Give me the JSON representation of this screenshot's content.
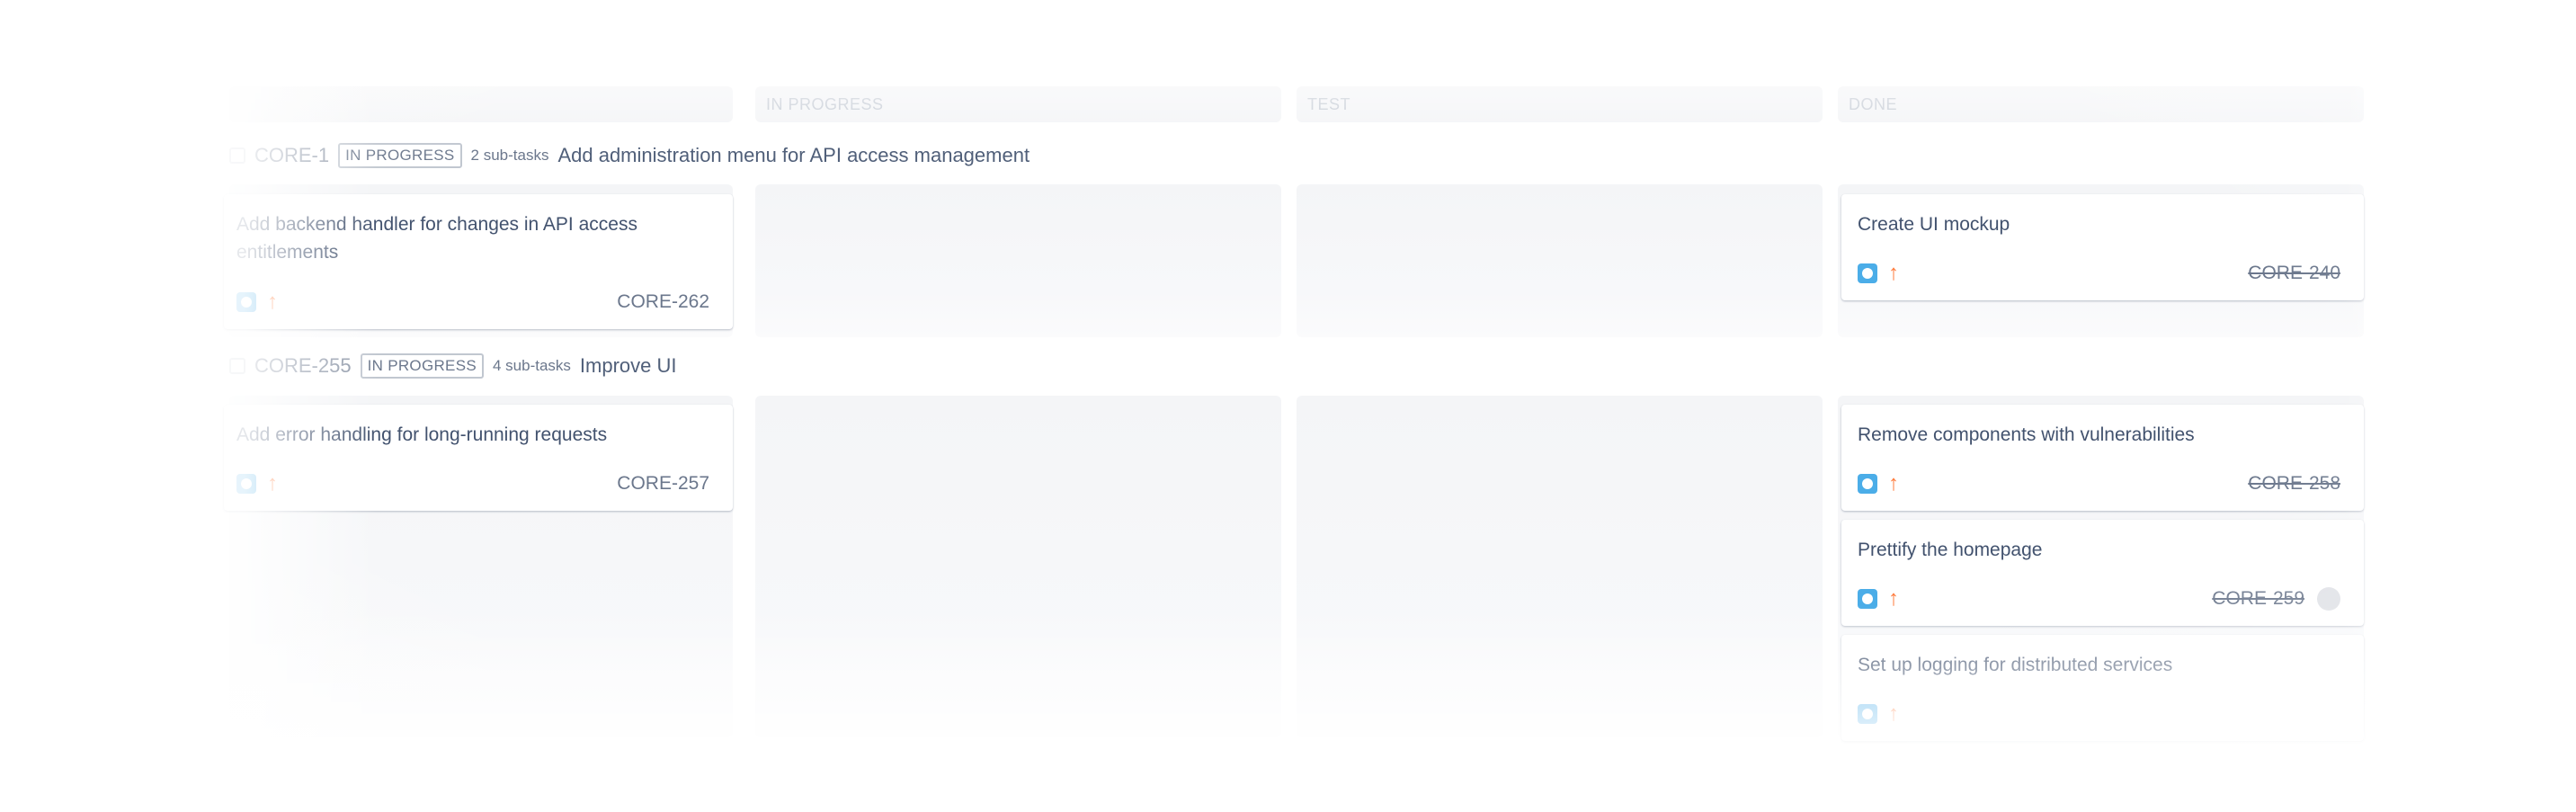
{
  "columns": [
    {
      "name": ""
    },
    {
      "name": "IN PROGRESS"
    },
    {
      "name": "TEST"
    },
    {
      "name": "DONE"
    }
  ],
  "swimlanes": [
    {
      "key": "CORE-1",
      "status": "IN PROGRESS",
      "subtasks": "2 sub-tasks",
      "summary": "Add administration menu for API access management",
      "cards": {
        "todo": {
          "title": "Add backend handler for changes in API access entitlements",
          "key": "CORE-262"
        },
        "done": [
          {
            "title": "Create UI mockup",
            "key": "CORE-240"
          }
        ]
      }
    },
    {
      "key": "CORE-255",
      "status": "IN PROGRESS",
      "subtasks": "4 sub-tasks",
      "summary": "Improve UI",
      "cards": {
        "todo": {
          "title": "Add error handling for long-running requests",
          "key": "CORE-257"
        },
        "done": [
          {
            "title": "Remove components with vulnerabilities",
            "key": "CORE-258"
          },
          {
            "title": "Prettify the homepage",
            "key": "CORE-259"
          },
          {
            "title": "Set up logging for distributed services",
            "key": ""
          }
        ]
      }
    }
  ],
  "colors": {
    "story_icon": "#4bade8",
    "priority_high": "#ff7b3c",
    "column_bg": "#f4f5f7"
  },
  "icons": {
    "type": "task-type-icon",
    "priority": "priority-high-icon",
    "checkbox": "checkbox-icon"
  }
}
